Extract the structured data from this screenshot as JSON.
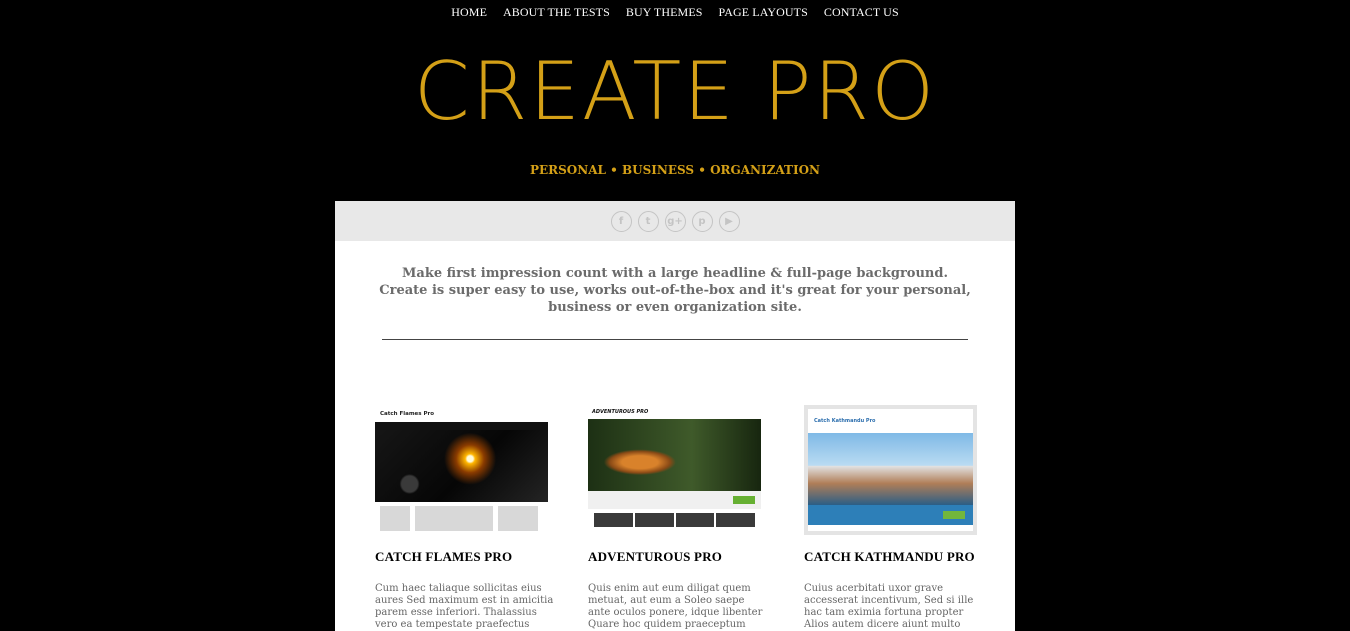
{
  "nav": {
    "items": [
      {
        "label": "HOME"
      },
      {
        "label": "ABOUT THE TESTS"
      },
      {
        "label": "BUY THEMES"
      },
      {
        "label": "PAGE LAYOUTS"
      },
      {
        "label": "CONTACT US"
      }
    ]
  },
  "site": {
    "title": "CREATE PRO",
    "tagline": "PERSONAL • BUSINESS • ORGANIZATION"
  },
  "social": {
    "icons": [
      {
        "name": "facebook-icon",
        "glyph": "f"
      },
      {
        "name": "twitter-icon",
        "glyph": "t"
      },
      {
        "name": "google-plus-icon",
        "glyph": "g+"
      },
      {
        "name": "pinterest-icon",
        "glyph": "p"
      },
      {
        "name": "youtube-icon",
        "glyph": "▶"
      }
    ]
  },
  "intro": {
    "line1": "Make first impression count with a large headline & full-page background.",
    "line2": "Create is super easy to use, works out-of-the-box and it's great for your personal, business or even organization site."
  },
  "features": [
    {
      "title": "CATCH FLAMES PRO",
      "thumb_title": "Catch Flames Pro",
      "text": "Cum haec taliaque sollicitas eius aures Sed maximum est in amicitia parem esse inferiori. Thalassius vero ea tempestate praefectus praetorio"
    },
    {
      "title": "ADVENTUROUS PRO",
      "thumb_title": "ADVENTUROUS PRO",
      "text": "Quis enim aut eum diligat quem metuat, aut eum a Soleo saepe ante oculos ponere, idque libenter Quare hoc quidem praeceptum"
    },
    {
      "title": "CATCH KATHMANDU PRO",
      "thumb_title": "Catch Kathmandu Pro",
      "text": "Cuius acerbitati uxor grave accesserat incentivum, Sed si ille hac tam eximia fortuna propter Alios autem dicere aiunt multo etiam"
    }
  ]
}
